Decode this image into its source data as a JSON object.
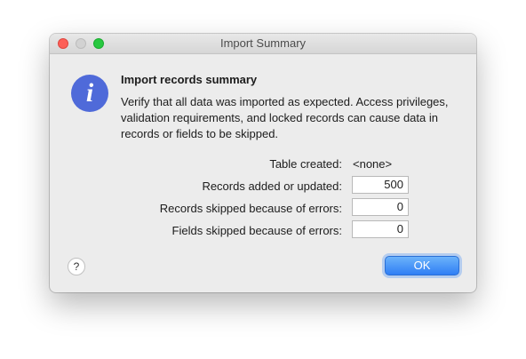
{
  "window": {
    "title": "Import Summary"
  },
  "dialog": {
    "icon": "info-icon",
    "heading": "Import records summary",
    "message": "Verify that all data was imported as expected. Access privileges, validation requirements, and locked records can cause data in records or fields to be skipped."
  },
  "summary": {
    "table_created_label": "Table created:",
    "table_created_value": "<none>",
    "records_added_label": "Records added or updated:",
    "records_added_value": "500",
    "records_skipped_label": "Records skipped because of errors:",
    "records_skipped_value": "0",
    "fields_skipped_label": "Fields skipped because of errors:",
    "fields_skipped_value": "0"
  },
  "buttons": {
    "help_label": "?",
    "ok_label": "OK"
  },
  "colors": {
    "accent": "#2f7ef5",
    "info_icon": "#4f6ad9",
    "close": "#fd5f57",
    "zoom": "#28c840"
  }
}
